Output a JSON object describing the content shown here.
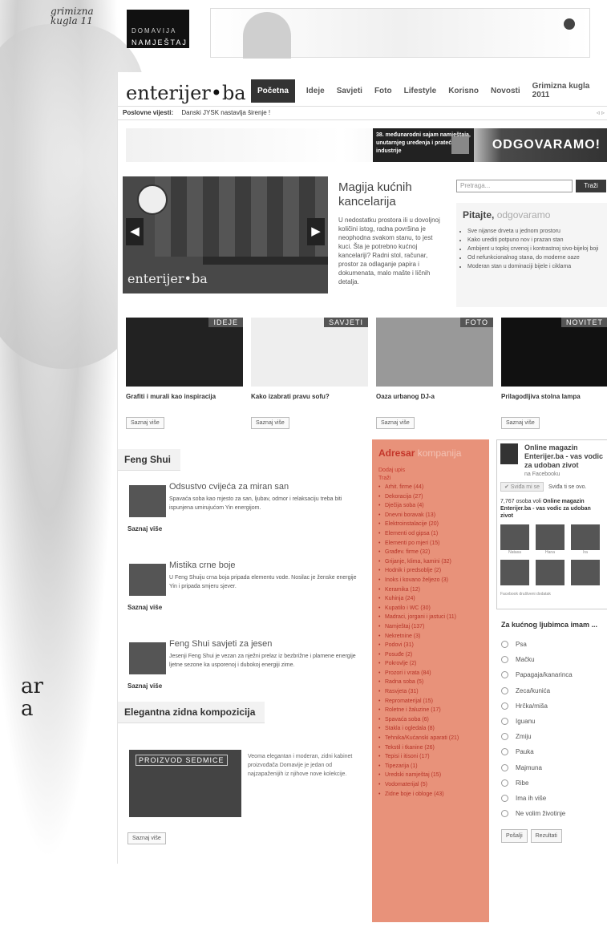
{
  "brand": {
    "corner_logo": "grimizna kugla 11",
    "banner_brand": "DOMAVIJA",
    "banner_brand_sub": "NAMJEŠTAJ",
    "site_logo": "enterijer",
    "site_logo_dot": "•",
    "site_logo_suffix": "ba"
  },
  "nav": {
    "items": [
      "Početna",
      "Ideje",
      "Savjeti",
      "Foto",
      "Lifestyle",
      "Korisno",
      "Novosti",
      "Grimizna kugla 2011"
    ]
  },
  "news": {
    "label": "Poslovne vijesti:",
    "text": "Danski JYSK nastavlja širenje !",
    "arrows": "◃ ▹"
  },
  "promo": {
    "fair_text": "38. međunarodni sajam namještaja, unutarnjeg uređenja i prateće industrije",
    "cta": "ODGOVARAMO!"
  },
  "feature": {
    "slider_logo": "enterijer•ba",
    "prev": "◀",
    "next": "▶",
    "title": "Magija kućnih kancelarija",
    "body": "U nedostatku prostora ili u dovoljnoj količini istog, radna površina je neophodna svakom stanu, to jest kuci. Šta je potrebno kućnoj kancelariji? Radni stol, računar, prostor za odlaganje papira i dokumenata, malo mašte i ličnih detalja."
  },
  "search": {
    "placeholder": "Pretraga...",
    "button": "Traži"
  },
  "ask": {
    "title_a": "Pitajte, ",
    "title_b": "odgovaramo",
    "items": [
      "Sve nijanse drveta u jednom prostoru",
      "Kako urediti potpuno nov i prazan stan",
      "Ambijent u toploj crvenoj i kontrastnoj sivo-bijeloj boji",
      "Od nefunkcionalnog stana, do moderne oaze",
      "Moderan stan u dominaciji bijele i ciklama"
    ]
  },
  "categories": [
    {
      "label": "IDEJE",
      "title": "Grafiti i murali kao inspiracija",
      "button": "Saznaj više"
    },
    {
      "label": "SAVJETI",
      "title": "Kako izabrati pravu sofu?",
      "button": "Saznaj više"
    },
    {
      "label": "FOTO",
      "title": "Oaza urbanog DJ-a",
      "button": "Saznaj više"
    },
    {
      "label": "NOVITET",
      "title": "Prilagodljiva stolna lampa",
      "button": "Saznaj više"
    }
  ],
  "fengshui": {
    "title": "Feng Shui",
    "items": [
      {
        "title": "Odsustvo cvijeća za miran san",
        "body": "Spavaća soba kao mjesto za san, ljubav, odmor i relaksaciju treba biti ispunjena umirujućom Yin energijom.",
        "more": "Saznaj više"
      },
      {
        "title": "Mistika crne boje",
        "body": "U Feng Shuiju crna boja pripada elementu vode. Nosilac je ženske energije Yin i pripada smjeru sjever.",
        "more": "Saznaj više"
      },
      {
        "title": "Feng Shui savjeti za jesen",
        "body": "Jesenji Feng Shui je vezan za nježni prelaz iz bezbrižne i plamene energije ljetne sezone ka usporenoj i dubokoj energiji zime.",
        "more": "Saznaj više"
      }
    ]
  },
  "elegant": {
    "title": "Elegantna zidna kompozicija",
    "img_label": "PROIZVOD SEDMICE",
    "body": "Veoma elegantan i moderan, zidni kabinet proizvođača Domavije je jedan od najzapaženijih iz njihove nove kolekcije.",
    "more": "Saznaj više"
  },
  "directory": {
    "title_a": "Adresar ",
    "title_b": "kompanija",
    "add": "Dodaj upis",
    "search": "Traži",
    "items": [
      "Arhit. firme (44)",
      "Dekoracija (27)",
      "Dječija soba (4)",
      "Dnevni boravak (13)",
      "Elektroinstalacije (20)",
      "Elementi od gipsa (1)",
      "Elementi po mjeri (15)",
      "Građev. firme (32)",
      "Grijanje, klima, kamini (32)",
      "Hodnik i predsoblje (2)",
      "Inoks i kovano željezo (3)",
      "Keramika (12)",
      "Kuhinja (24)",
      "Kupatilo i WC (30)",
      "Madraci, jorgani i jastuci (11)",
      "Namještaj (137)",
      "Nekretnine (3)",
      "Podovi (31)",
      "Posuđe (2)",
      "Pokrovlje (2)",
      "Prozori i vrata (84)",
      "Radna soba (5)",
      "Rasvjeta (31)",
      "Repromaterijal (15)",
      "Roletne i žaluzine (17)",
      "Spavaća soba (6)",
      "Stakla i ogledala (8)",
      "Tehnika/Kućanski aparati (21)",
      "Tekstil i tkanine (26)",
      "Tepisi i itisoni (17)",
      "Tipezarija (1)",
      "Uredski namještaj (15)",
      "Vodomaterijal (5)",
      "Zidne boje i obloge (43)"
    ]
  },
  "facebook": {
    "title": "Online magazin Enterijer.ba - vas vodic za udoban zivot",
    "sub": "na Facebooku",
    "like_btn": "✔ Sviđa mi se",
    "like_text": "Sviđa ti se ovo.",
    "count_prefix": "7,767 osoba voli ",
    "count_name": "Online magazin Enterijer.ba - vas vodic za udoban zivot",
    "faces": [
      "Natasa",
      "Hana",
      "Ira",
      "",
      "",
      ""
    ],
    "plugin": "Facebook društveni dodatak"
  },
  "poll": {
    "title": "Za kućnog ljubimca imam ...",
    "options": [
      "Psa",
      "Mačku",
      "Papagaja/kanarinca",
      "Zeca/kunića",
      "Hrčka/miša",
      "Iguanu",
      "Zmiju",
      "Pauka",
      "Majmuna",
      "Ribe",
      "Ima ih više",
      "Ne volim životinje"
    ],
    "submit": "Pošalji",
    "results": "Rezultati"
  },
  "side_text": {
    "line1": "ar",
    "line2": "a"
  }
}
